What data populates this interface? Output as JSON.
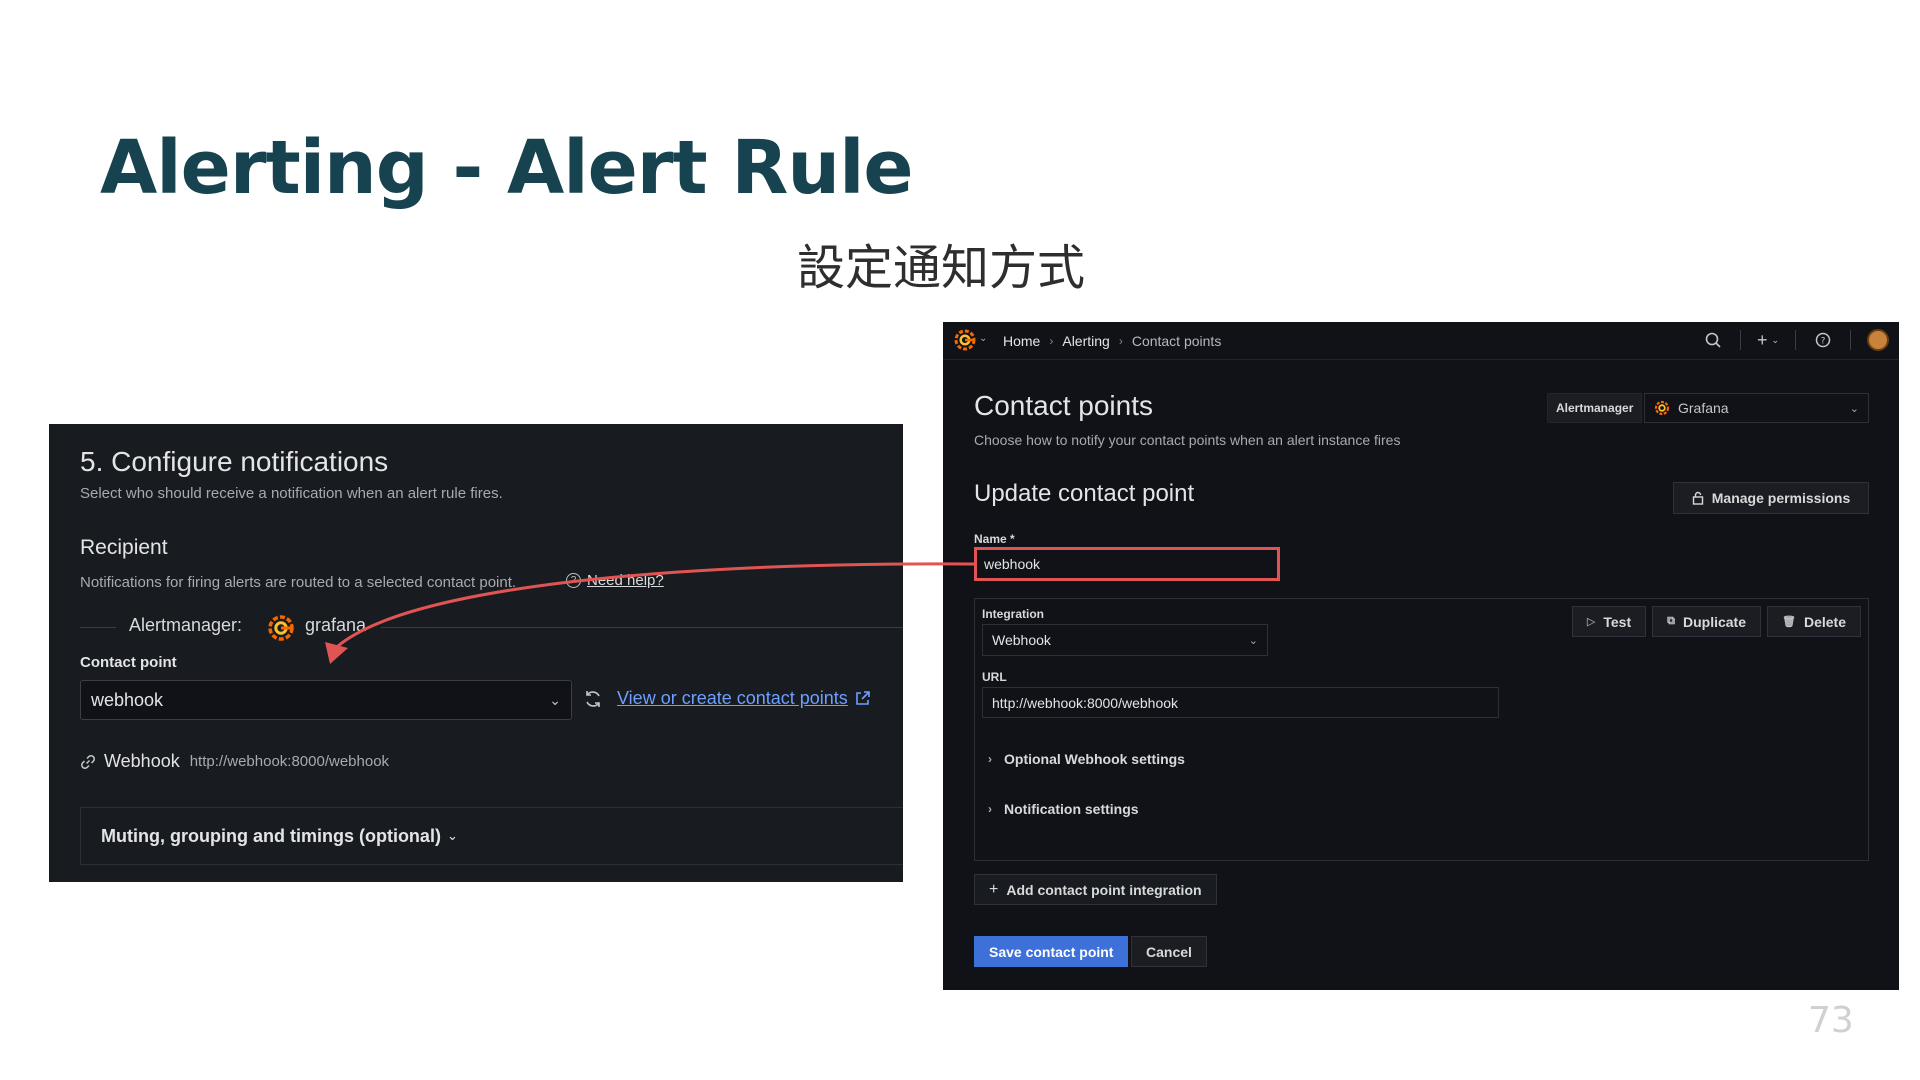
{
  "slide": {
    "title": "Alerting - Alert Rule",
    "subtitle": "設定通知方式",
    "page_number": "73"
  },
  "left_panel": {
    "title": "5. Configure notifications",
    "description": "Select who should receive a notification when an alert rule fires.",
    "recipient_heading": "Recipient",
    "routed_text": "Notifications for firing alerts are routed to a selected contact point.",
    "need_help": "Need help?",
    "alertmanager_label": "Alertmanager:",
    "alertmanager_value": "grafana",
    "contact_point_label": "Contact point",
    "contact_point_value": "webhook",
    "view_link": "View or create contact points",
    "webhook_type": "Webhook",
    "webhook_url": "http://webhook:8000/webhook",
    "muting_label": "Muting, grouping and timings (optional)"
  },
  "right_panel": {
    "breadcrumb": [
      "Home",
      "Alerting",
      "Contact points"
    ],
    "title": "Contact points",
    "subtitle": "Choose how to notify your contact points when an alert instance fires",
    "alertmanager_label": "Alertmanager",
    "alertmanager_value": "Grafana",
    "section_title": "Update contact point",
    "manage_permissions": "Manage permissions",
    "name_label": "Name *",
    "name_value": "webhook",
    "integration_label": "Integration",
    "integration_value": "Webhook",
    "url_label": "URL",
    "url_value": "http://webhook:8000/webhook",
    "optional_settings": "Optional Webhook settings",
    "notification_settings": "Notification settings",
    "test_button": "Test",
    "duplicate_button": "Duplicate",
    "delete_button": "Delete",
    "add_integration": "Add contact point integration",
    "save_button": "Save contact point",
    "cancel_button": "Cancel"
  },
  "colors": {
    "title": "#17424f",
    "panel_bg": "#181b1f",
    "grafana_bg": "#111217",
    "link_blue": "#6e9fff",
    "primary_button": "#3d71d9",
    "highlight_red": "#e05454",
    "grafana_orange": "#f46800"
  }
}
